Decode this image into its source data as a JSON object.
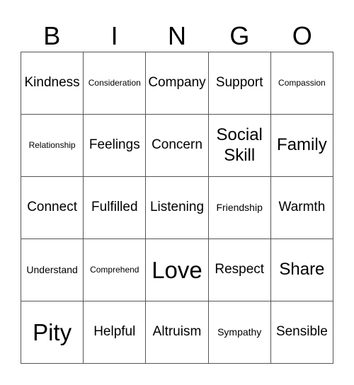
{
  "header": [
    "B",
    "I",
    "N",
    "G",
    "O"
  ],
  "cells": [
    {
      "text": "Kindness",
      "size": "s-md"
    },
    {
      "text": "Consideration",
      "size": "s-xs"
    },
    {
      "text": "Company",
      "size": "s-md"
    },
    {
      "text": "Support",
      "size": "s-md"
    },
    {
      "text": "Compassion",
      "size": "s-xs"
    },
    {
      "text": "Relationship",
      "size": "s-xs"
    },
    {
      "text": "Feelings",
      "size": "s-md"
    },
    {
      "text": "Concern",
      "size": "s-md"
    },
    {
      "text": "Social Skill",
      "size": "s-lg"
    },
    {
      "text": "Family",
      "size": "s-lg"
    },
    {
      "text": "Connect",
      "size": "s-md"
    },
    {
      "text": "Fulfilled",
      "size": "s-md"
    },
    {
      "text": "Listening",
      "size": "s-md"
    },
    {
      "text": "Friendship",
      "size": "s-sm"
    },
    {
      "text": "Warmth",
      "size": "s-md"
    },
    {
      "text": "Understand",
      "size": "s-sm"
    },
    {
      "text": "Comprehend",
      "size": "s-xs"
    },
    {
      "text": "Love",
      "size": "s-xl"
    },
    {
      "text": "Respect",
      "size": "s-md"
    },
    {
      "text": "Share",
      "size": "s-lg"
    },
    {
      "text": "Pity",
      "size": "s-xl"
    },
    {
      "text": "Helpful",
      "size": "s-md"
    },
    {
      "text": "Altruism",
      "size": "s-md"
    },
    {
      "text": "Sympathy",
      "size": "s-sm"
    },
    {
      "text": "Sensible",
      "size": "s-md"
    }
  ]
}
